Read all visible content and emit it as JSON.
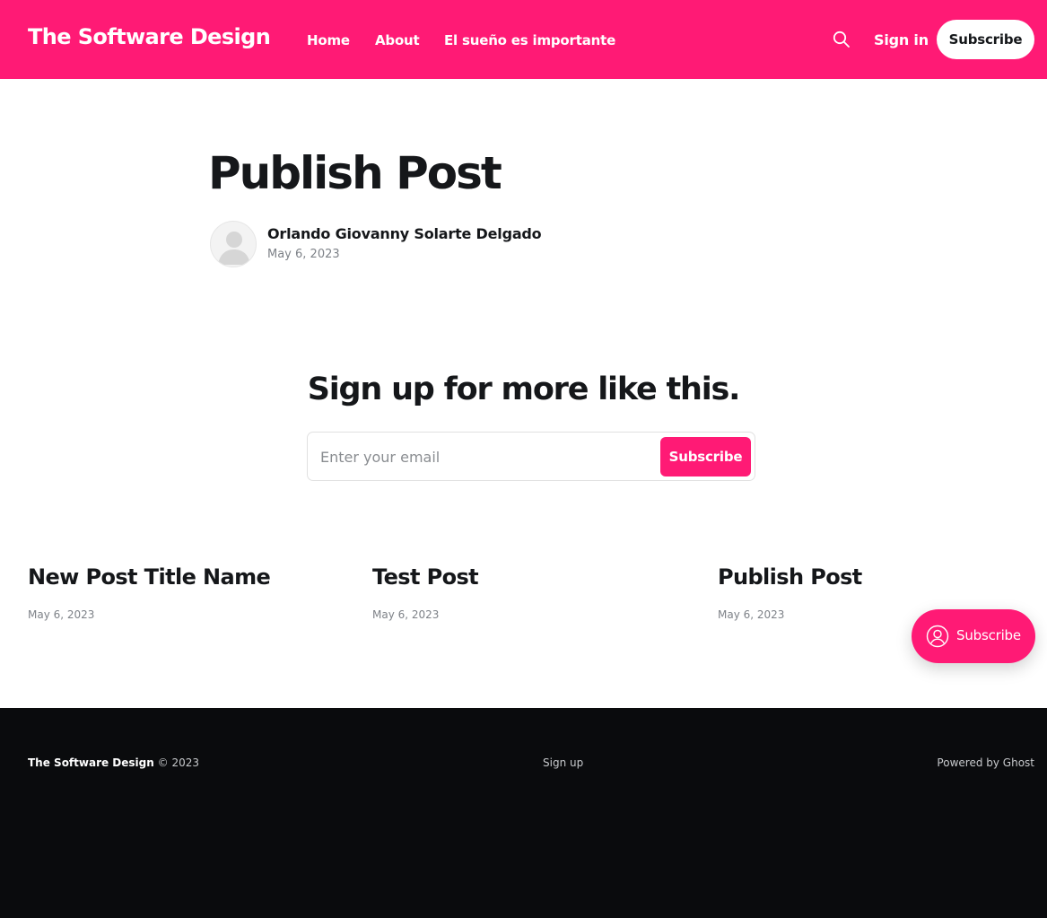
{
  "colors": {
    "accent": "#ff1a75",
    "footer_bg": "#0a0b0d",
    "text": "#15171a",
    "muted": "#7e8288"
  },
  "header": {
    "site_title": "The Software Design",
    "nav": [
      {
        "label": "Home"
      },
      {
        "label": "About"
      },
      {
        "label": "El sueño es importante"
      }
    ],
    "search_icon": "search-icon",
    "signin_label": "Sign in",
    "subscribe_label": "Subscribe"
  },
  "post": {
    "title": "Publish Post",
    "author": "Orlando Giovanny Solarte Delgado",
    "date": "May 6, 2023",
    "avatar_icon": "user-placeholder-icon"
  },
  "cta": {
    "title": "Sign up for more like this.",
    "email_placeholder": "Enter your email",
    "email_value": "",
    "button_label": "Subscribe"
  },
  "related_posts": [
    {
      "title": "New Post Title Name",
      "date": "May 6, 2023"
    },
    {
      "title": "Test Post",
      "date": "May 6, 2023"
    },
    {
      "title": "Publish Post",
      "date": "May 6, 2023"
    }
  ],
  "floating": {
    "label": "Subscribe",
    "icon": "user-circle-icon"
  },
  "footer": {
    "brand": "The Software Design",
    "copyright": "© 2023",
    "signup_label": "Sign up",
    "powered_by": "Powered by Ghost"
  }
}
